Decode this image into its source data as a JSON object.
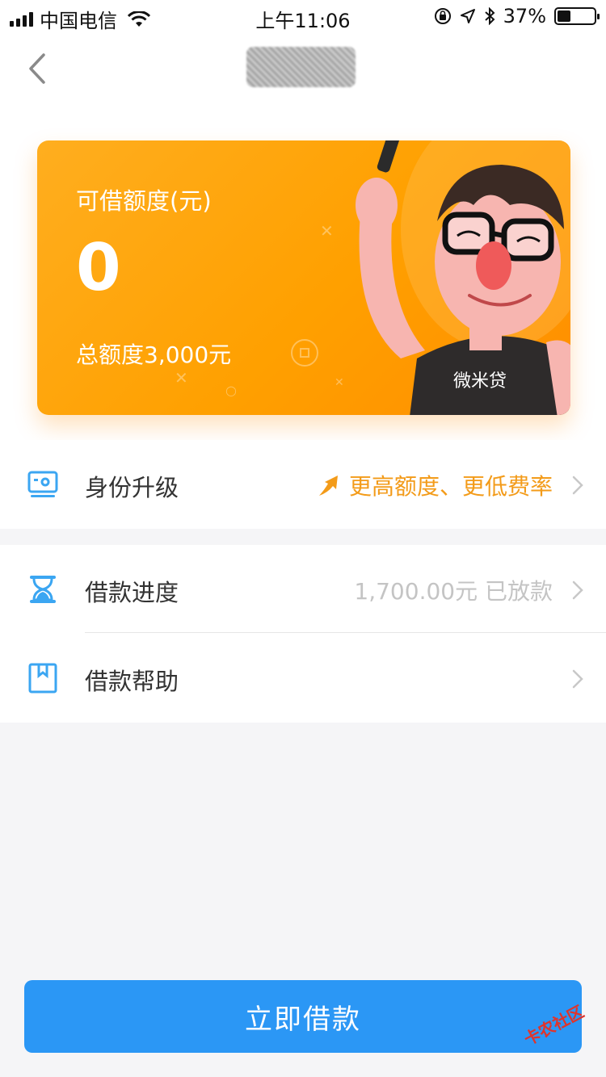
{
  "status_bar": {
    "carrier": "中国电信",
    "time": "上午11:06",
    "battery_percent": "37%",
    "battery_level": 0.37
  },
  "nav": {
    "back_icon": "chevron-left-icon",
    "title_redacted": true
  },
  "card": {
    "label": "可借额度(元)",
    "amount": "0",
    "total": "总额度3,000元",
    "mascot_shirt_text": "微米贷",
    "colors": {
      "start": "#ffae1f",
      "end": "#ff8e00"
    }
  },
  "menu": {
    "upgrade": {
      "icon": "id-card-icon",
      "label": "身份升级",
      "value": "更高额度、更低费率",
      "value_color": "#f39b19"
    },
    "progress": {
      "icon": "hourglass-icon",
      "label": "借款进度",
      "value": "1,700.00元 已放款",
      "value_color": "#c4c4c4"
    },
    "help": {
      "icon": "bookmark-icon",
      "label": "借款帮助"
    }
  },
  "action": {
    "borrow_label": "立即借款",
    "color": "#2b97f5"
  },
  "watermark": "卡农社区"
}
